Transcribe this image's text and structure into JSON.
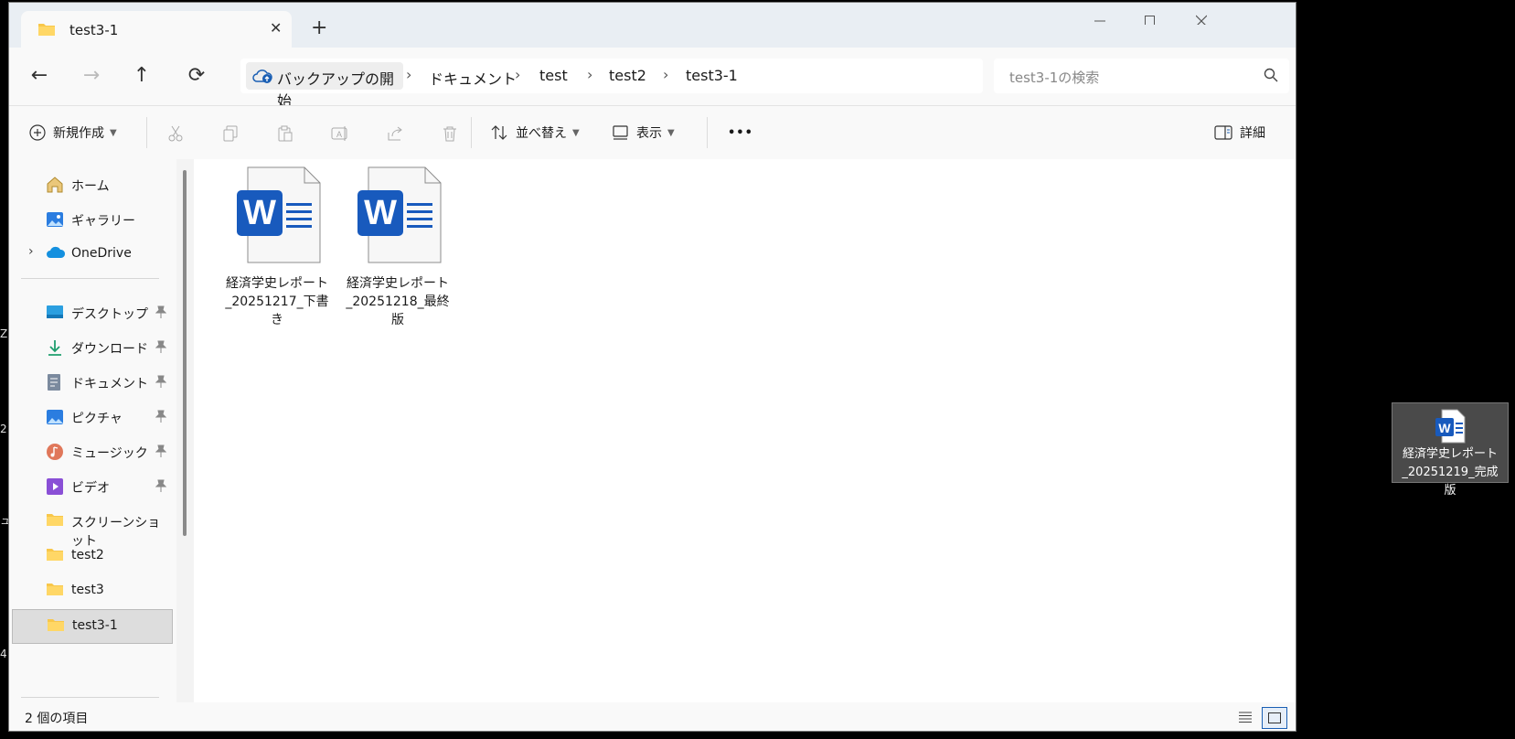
{
  "window": {
    "tab_title": "test3-1",
    "new_tab": "+",
    "close_tab": "✕"
  },
  "nav": {
    "back": "←",
    "forward": "→",
    "up": "↑",
    "refresh": "⟳"
  },
  "breadcrumb": [
    "バックアップの開始",
    "ドキュメント",
    "test",
    "test2",
    "test3-1"
  ],
  "breadcrumb_sep": "›",
  "search": {
    "placeholder": "test3-1の検索"
  },
  "toolbar": {
    "new_label": "新規作成",
    "sort_label": "並べ替え",
    "view_label": "表示",
    "more_label": "•••",
    "details_label": "詳細"
  },
  "sidebar": {
    "top": [
      {
        "label": "ホーム"
      },
      {
        "label": "ギャラリー"
      },
      {
        "label": "OneDrive"
      }
    ],
    "pinned": [
      {
        "label": "デスクトップ"
      },
      {
        "label": "ダウンロード"
      },
      {
        "label": "ドキュメント"
      },
      {
        "label": "ピクチャ"
      },
      {
        "label": "ミュージック"
      },
      {
        "label": "ビデオ"
      }
    ],
    "folders": [
      {
        "label": "スクリーンショット"
      },
      {
        "label": "test2"
      },
      {
        "label": "test3"
      },
      {
        "label": "test3-1"
      }
    ]
  },
  "files": [
    {
      "name": "経済学史レポート_20251217_下書き"
    },
    {
      "name": "経済学史レポート_20251218_最終版"
    }
  ],
  "status": {
    "count": "2 個の項目"
  },
  "desktop": {
    "file_name": "経済学史レポート_20251219_完成版",
    "edge_text": [
      "Z",
      "2",
      "ュ",
      "4"
    ]
  },
  "colors": {
    "word_blue": "#185abd",
    "folder_yellow": "#f8c74a",
    "accent": "#1a5fb4"
  }
}
